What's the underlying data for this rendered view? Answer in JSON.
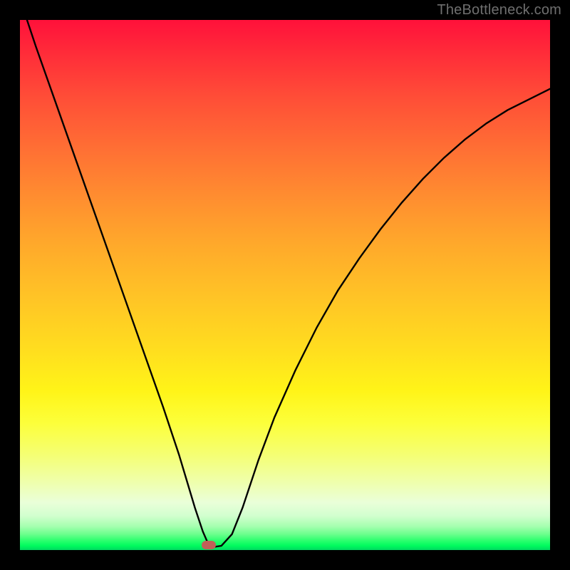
{
  "watermark": "TheBottleneck.com",
  "chart_data": {
    "type": "line",
    "title": "",
    "xlabel": "",
    "ylabel": "",
    "xlim": [
      0,
      100
    ],
    "ylim": [
      0,
      100
    ],
    "grid": false,
    "legend": false,
    "series": [
      {
        "name": "bottleneck-curve",
        "x": [
          0,
          3,
          6,
          9,
          12,
          15,
          18,
          21,
          24,
          27,
          30,
          31.5,
          33,
          34.5,
          35.5,
          36,
          38,
          40,
          42,
          45,
          48,
          52,
          56,
          60,
          64,
          68,
          72,
          76,
          80,
          84,
          88,
          92,
          96,
          100
        ],
        "y": [
          104,
          95,
          86.5,
          78,
          69.5,
          61,
          52.5,
          44,
          35.5,
          27,
          18,
          13,
          8,
          3.5,
          1.2,
          0.5,
          0.8,
          3,
          8,
          17,
          25,
          34,
          42,
          49,
          55,
          60.5,
          65.5,
          70,
          74,
          77.5,
          80.5,
          83,
          85,
          87
        ]
      }
    ],
    "marker": {
      "x": 35.6,
      "y": 0.9
    },
    "annotations": []
  },
  "colors": {
    "curve": "#000000",
    "marker": "#c06058",
    "frame": "#000000"
  }
}
